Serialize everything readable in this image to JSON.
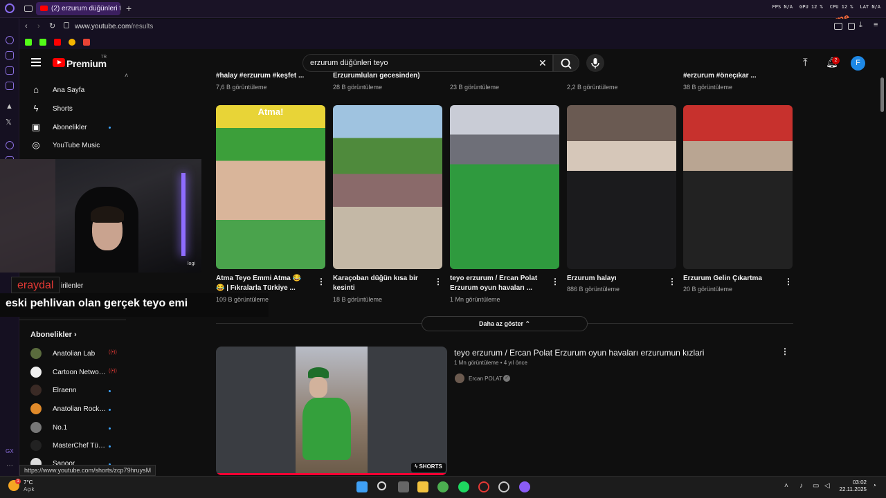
{
  "browser": {
    "tab_title": "(2) erzurum düğünleri teyo",
    "new_tab": "+",
    "url_host": "www.youtube.com",
    "url_path": "/results",
    "stats": [
      "FPS N/A",
      "GPU 12 %",
      "CPU 12 %",
      "LAT N/A"
    ],
    "status_url": "https://www.youtube.com/shorts/zcp79hruysM"
  },
  "header": {
    "brand": "Premium",
    "region": "TR",
    "search_query": "erzurum düğünleri teyo",
    "notification_count": "2",
    "avatar_letter": "F"
  },
  "sidebar": {
    "nav": [
      {
        "label": "Ana Sayfa",
        "icon": "home-icon"
      },
      {
        "label": "Shorts",
        "icon": "shorts-icon"
      },
      {
        "label": "Abonelikler",
        "icon": "subscriptions-icon"
      },
      {
        "label": "YouTube Music",
        "icon": "music-icon"
      }
    ],
    "partial_label": "irilenler",
    "subs_heading": "Abonelikler",
    "subs": [
      {
        "name": "Anatolian Lab",
        "color": "#5a6b3d",
        "live": true
      },
      {
        "name": "Cartoon Network...",
        "color": "#f0f0f0",
        "live": true
      },
      {
        "name": "Elraenn",
        "color": "#3a2a25",
        "live": false
      },
      {
        "name": "Anatolian Rocka...",
        "color": "#e08a2a",
        "live": false
      },
      {
        "name": "No.1",
        "color": "#777777",
        "live": false
      },
      {
        "name": "MasterChef Türk...",
        "color": "#222222",
        "live": false
      },
      {
        "name": "Sapoor",
        "color": "#dddddd",
        "live": false
      }
    ]
  },
  "stream_overlay": {
    "username": "eraydal",
    "message": "eski pehlivan olan gerçek teyo emi",
    "cam_logo": "logi"
  },
  "previous_row": [
    {
      "title": "#halay #erzurum #keşfet ...",
      "views": "7,6 B görüntüleme"
    },
    {
      "title": "Erzurumluları gecesinden)",
      "views": "28 B görüntüleme"
    },
    {
      "title": "",
      "views": "23 B görüntüleme"
    },
    {
      "title": "",
      "views": "2,2 B görüntüleme"
    },
    {
      "title": "#erzurum #öneçıkar ...",
      "views": "38 B görüntüleme"
    }
  ],
  "shorts": [
    {
      "title": "Atma Teyo Emmi Atma 😂 😂 | Fıkralarla Türkiye ...",
      "views": "109 B görüntüleme",
      "badge": "Atma!"
    },
    {
      "title": "Karaçoban düğün kısa bir kesinti",
      "views": "18 B görüntüleme",
      "badge": ""
    },
    {
      "title": "teyo erzurum / Ercan Polat Erzurum oyun havaları ...",
      "views": "1 Mn görüntüleme",
      "badge": ""
    },
    {
      "title": "Erzurum halayı",
      "views": "886 B görüntüleme",
      "badge": ""
    },
    {
      "title": "Erzurum Gelin Çıkartma",
      "views": "20 B görüntüleme",
      "badge": ""
    }
  ],
  "show_less": "Daha az göster",
  "result": {
    "title": "teyo erzurum / Ercan Polat Erzurum oyun havaları erzurumun kızlari",
    "views": "1 Mn görüntüleme",
    "age": "4 yıl önce",
    "channel": "Ercan POLAT",
    "badge": "SHORTS"
  },
  "taskbar": {
    "temp": "7°C",
    "weather": "Açık",
    "time": "03:02",
    "date": "22.11.2025"
  }
}
